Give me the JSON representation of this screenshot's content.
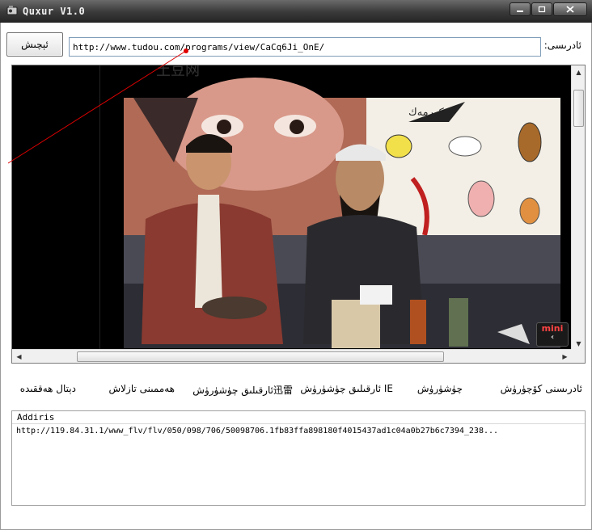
{
  "window": {
    "title": "Quxur V1.0"
  },
  "toolbar": {
    "go_label": "ئېچىش",
    "url_value": "http://www.tudou.com/programs/view/CaCq6Ji_OnE/",
    "address_label": "ئادرىسى:"
  },
  "video": {
    "mini_label": "mini",
    "mini_chevron": "‹",
    "watermark": "土豆网",
    "board_text": "كورمەك",
    "scroll_up": "▲",
    "scroll_down": "▼",
    "scroll_left": "◀",
    "scroll_right": "▶"
  },
  "actions": [
    {
      "label": "ئادرىسنى كۆچۈرۈش"
    },
    {
      "label": "چۈشۈرۈش"
    },
    {
      "label": "IE ئارقىلىق چۈشۈرۈش"
    },
    {
      "label": "迅雷ئارقىلىق چۈشۈرۈش"
    },
    {
      "label": "ھەممىنى تازلاش"
    },
    {
      "label": "دېتال ھەققىدە"
    }
  ],
  "log": {
    "header": "Addiris",
    "lines": [
      "http://119.84.31.1/www_flv/flv/050/098/706/50098706.1fb83ffa898180f4015437ad1c04a0b27b6c7394_238..."
    ]
  },
  "colors": {
    "titlebar": "#3a3a3a",
    "annotation_line": "#e00000",
    "mini_text": "#ff4444"
  }
}
